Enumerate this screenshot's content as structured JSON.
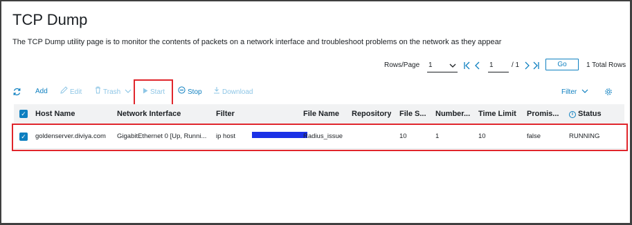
{
  "page": {
    "title": "TCP Dump",
    "description": "The TCP Dump utility page is to monitor the contents of packets on a network interface and troubleshoot problems on the network as they appear"
  },
  "pagination": {
    "rows_label": "Rows/Page",
    "rows_value": "1",
    "page_value": "1",
    "of_text": "/ 1",
    "go_label": "Go",
    "total_text": "1 Total Rows"
  },
  "toolbar": {
    "add_label": "Add",
    "edit_label": "Edit",
    "trash_label": "Trash",
    "start_label": "Start",
    "stop_label": "Stop",
    "download_label": "Download",
    "filter_label": "Filter"
  },
  "table": {
    "columns": {
      "host_name": "Host Name",
      "network_interface": "Network Interface",
      "filter": "Filter",
      "file_name": "File Name",
      "repository": "Repository",
      "file_size": "File S...",
      "number": "Number...",
      "time_limit": "Time Limit",
      "promiscuous": "Promis...",
      "status": "Status"
    },
    "rows": [
      {
        "host_name": "goldenserver.diviya.com",
        "network_interface": "GigabitEthernet 0 [Up, Runni...",
        "filter": "ip host",
        "file_name": "Radius_issue",
        "repository": "",
        "file_size": "10",
        "number": "1",
        "time_limit": "10",
        "promiscuous": "false",
        "status": "RUNNING"
      }
    ]
  },
  "colors": {
    "accent": "#0d7fc0",
    "highlight_box": "#e0252b",
    "redaction": "#1b31e6"
  }
}
